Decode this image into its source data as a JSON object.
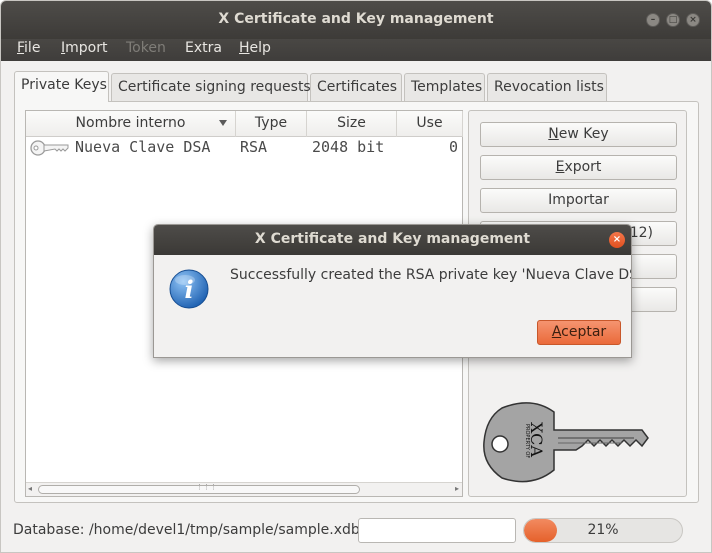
{
  "window": {
    "title": "X Certificate and Key management"
  },
  "menu": {
    "file": "File",
    "import": "Import",
    "token": "Token",
    "extra": "Extra",
    "help": "Help"
  },
  "tabs": [
    {
      "label": "Private Keys",
      "active": true
    },
    {
      "label": "Certificate signing requests"
    },
    {
      "label": "Certificates"
    },
    {
      "label": "Templates"
    },
    {
      "label": "Revocation lists"
    }
  ],
  "keytable": {
    "columns": [
      "Nombre interno",
      "Type",
      "Size",
      "Use"
    ],
    "rows": [
      {
        "name": "Nueva Clave DSA",
        "type": "RSA",
        "size": "2048 bit",
        "use": "0",
        "icon": "key-icon"
      }
    ]
  },
  "buttons": {
    "new_key": "New Key",
    "export": "Export",
    "import": "Importar",
    "pfx_partial": "12)"
  },
  "status": {
    "database": "Database: /home/devel1/tmp/sample/sample.xdb",
    "progress_value": 0.21,
    "progress_label": "21%"
  },
  "dialog": {
    "title": "X Certificate and Key management",
    "message": "Successfully created the RSA private key 'Nueva Clave DSA'",
    "ok": "Aceptar",
    "icon": "info-icon"
  },
  "logo_text": {
    "property": "PROPERTY OF",
    "brand": "XCA"
  },
  "colors": {
    "accent": "#e95c27",
    "titlebar": "#3f3d3b"
  }
}
